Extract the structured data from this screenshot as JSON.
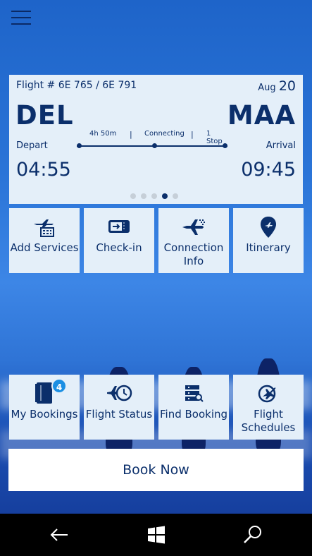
{
  "flight": {
    "number": "Flight # 6E 765 / 6E 791",
    "month": "Aug",
    "day": "20",
    "from_code": "DEL",
    "to_code": "MAA",
    "depart_label": "Depart",
    "arrival_label": "Arrival",
    "depart_time": "04:55",
    "arrive_time": "09:45",
    "duration": "4h 50m",
    "connection_type": "Connecting",
    "stops": "1 Stop",
    "pager": {
      "count": 5,
      "active_index": 3
    }
  },
  "tiles_top": [
    {
      "label": "Add Services",
      "icon": "add-services-icon"
    },
    {
      "label": "Check-in",
      "icon": "boarding-pass-icon"
    },
    {
      "label": "Connection Info",
      "icon": "connecting-plane-icon"
    },
    {
      "label": "Itinerary",
      "icon": "location-pin-icon"
    }
  ],
  "tiles_bottom": [
    {
      "label": "My Bookings",
      "icon": "booklet-icon",
      "badge": "4"
    },
    {
      "label": "Flight Status",
      "icon": "plane-clock-icon"
    },
    {
      "label": "Find Booking",
      "icon": "list-search-icon"
    },
    {
      "label": "Flight Schedules",
      "icon": "plane-circle-icon"
    }
  ],
  "book_now": {
    "label": "Book Now"
  },
  "navbar": {
    "icons": [
      "back-arrow-icon",
      "windows-start-icon",
      "search-icon"
    ]
  },
  "colors": {
    "card_bg": "#e4eff9",
    "text_primary": "#0b2f6b",
    "badge": "#1b8fe3",
    "navbar_bg": "#000000"
  }
}
